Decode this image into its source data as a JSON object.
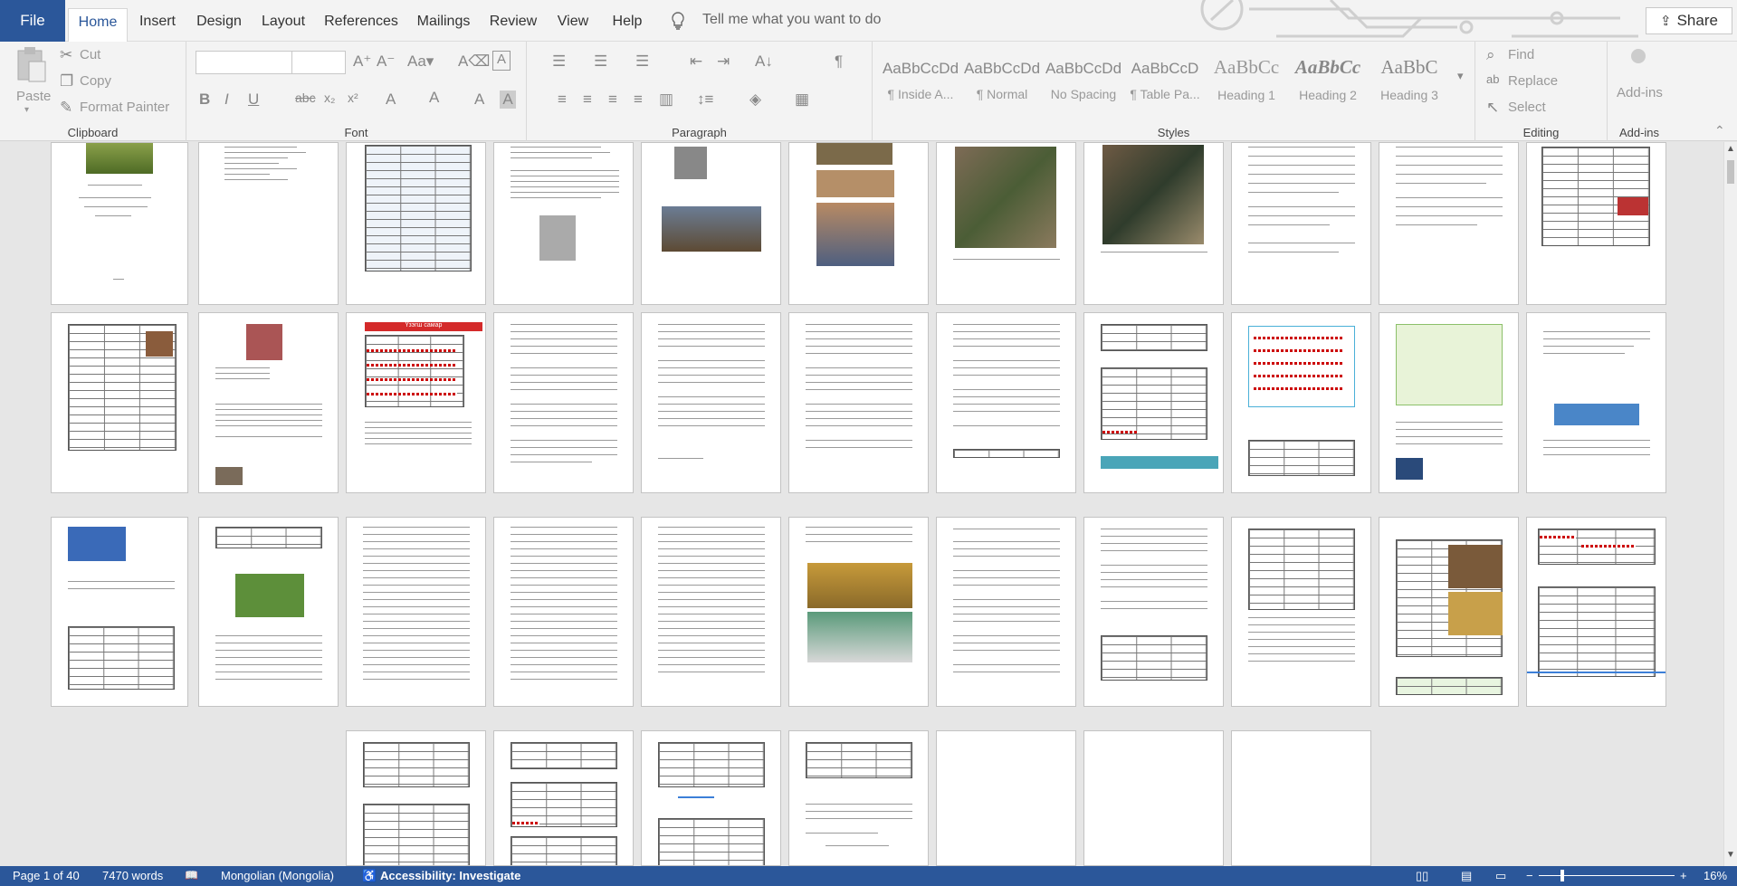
{
  "tabs": {
    "file": "File",
    "items": [
      "Home",
      "Insert",
      "Design",
      "Layout",
      "References",
      "Mailings",
      "Review",
      "View",
      "Help"
    ],
    "active": "Home"
  },
  "tellme": "Tell me what you want to do",
  "share": "Share",
  "clipboard": {
    "paste": "Paste",
    "cut": "Cut",
    "copy": "Copy",
    "format_painter": "Format Painter",
    "group": "Clipboard"
  },
  "font": {
    "group": "Font"
  },
  "paragraph": {
    "group": "Paragraph"
  },
  "styles": {
    "group": "Styles",
    "items": [
      {
        "preview": "AaBbCcDd",
        "name": "¶ Inside A..."
      },
      {
        "preview": "AaBbCcDd",
        "name": "¶ Normal"
      },
      {
        "preview": "AaBbCcDd",
        "name": "No Spacing"
      },
      {
        "preview": "AaBbCcD",
        "name": "¶ Table Pa..."
      },
      {
        "preview": "AaBbCc",
        "name": "Heading 1"
      },
      {
        "preview": "AaBbCc",
        "name": "Heading 2"
      },
      {
        "preview": "AaBbC",
        "name": "Heading 3"
      }
    ]
  },
  "editing": {
    "group": "Editing",
    "find": "Find",
    "replace": "Replace",
    "select": "Select"
  },
  "addins": {
    "group": "Add-ins",
    "label": "Add-ins"
  },
  "doc": {
    "banner": "Үзэгш самар"
  },
  "status": {
    "page": "Page 1 of 40",
    "words": "7470 words",
    "language": "Mongolian (Mongolia)",
    "accessibility": "Accessibility: Investigate",
    "zoom": "16%"
  },
  "colors": {
    "accent": "#2b579a",
    "ribbon": "#f3f3f3",
    "canvas": "#e6e6e6"
  }
}
